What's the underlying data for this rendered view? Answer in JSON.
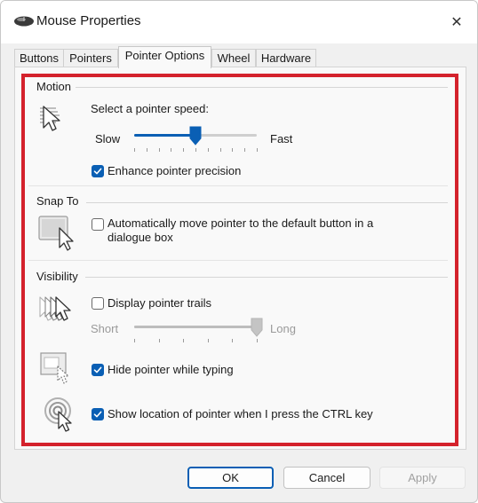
{
  "window": {
    "title": "Mouse Properties",
    "close_glyph": "✕"
  },
  "tabs": [
    {
      "label": "Buttons"
    },
    {
      "label": "Pointers"
    },
    {
      "label": "Pointer Options",
      "active": true
    },
    {
      "label": "Wheel"
    },
    {
      "label": "Hardware"
    }
  ],
  "motion": {
    "heading": "Motion",
    "speed_label": "Select a pointer speed:",
    "slow_label": "Slow",
    "fast_label": "Fast",
    "speed_value": 0.5,
    "enhance_label": "Enhance pointer precision",
    "enhance_checked": true,
    "icon": "pointer-speed-icon"
  },
  "snap_to": {
    "heading": "Snap To",
    "auto_move_line1": "Automatically move pointer to the default button in a",
    "auto_move_line2": "dialogue box",
    "auto_move_checked": false,
    "icon": "snap-to-icon"
  },
  "visibility": {
    "heading": "Visibility",
    "trails_label": "Display pointer trails",
    "trails_checked": false,
    "short_label": "Short",
    "long_label": "Long",
    "trail_length_value": 1.0,
    "hide_typing_label": "Hide pointer while typing",
    "hide_typing_checked": true,
    "ctrl_label": "Show location of pointer when I press the CTRL key",
    "ctrl_checked": true,
    "icons": [
      "pointer-trails-icon",
      "hide-pointer-icon",
      "locate-pointer-icon"
    ]
  },
  "footer": {
    "ok_label": "OK",
    "cancel_label": "Cancel",
    "apply_label": "Apply",
    "apply_enabled": false
  },
  "colors": {
    "accent": "#0a5fb4",
    "highlight_border": "#d4222c"
  }
}
